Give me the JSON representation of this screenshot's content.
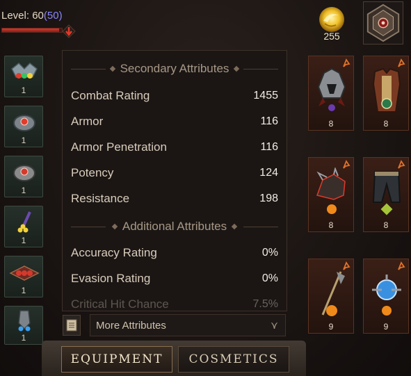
{
  "header": {
    "level_label": "Level: 60",
    "paragon_level": "(50)",
    "xp_fraction": 0.95
  },
  "currency": {
    "amount": "255",
    "icon": "gold-orb-icon"
  },
  "left_slots": [
    {
      "name": "helm-gem-slot",
      "level": "1",
      "icon": "crown-gem-icon"
    },
    {
      "name": "ring-slot-1",
      "level": "1",
      "icon": "ring-icon"
    },
    {
      "name": "ring-slot-2",
      "level": "1",
      "icon": "ring-icon"
    },
    {
      "name": "wand-slot",
      "level": "1",
      "icon": "wand-icon"
    },
    {
      "name": "belt-slot",
      "level": "1",
      "icon": "belt-icon"
    },
    {
      "name": "neck-slot",
      "level": "1",
      "icon": "amulet-icon"
    }
  ],
  "secondary": {
    "title": "Secondary Attributes",
    "rows": [
      {
        "name": "Combat Rating",
        "value": "1455"
      },
      {
        "name": "Armor",
        "value": "116"
      },
      {
        "name": "Armor Penetration",
        "value": "116"
      },
      {
        "name": "Potency",
        "value": "124"
      },
      {
        "name": "Resistance",
        "value": "198"
      }
    ]
  },
  "additional": {
    "title": "Additional Attributes",
    "rows": [
      {
        "name": "Accuracy Rating",
        "value": "0%"
      },
      {
        "name": "Evasion Rating",
        "value": "0%"
      },
      {
        "name": "Critical Hit Chance",
        "value": "7.5%"
      }
    ]
  },
  "more": {
    "label": "More Attributes",
    "chevron": "⋎"
  },
  "tabs": {
    "equipment": "EQUIPMENT",
    "cosmetics": "COSMETICS"
  },
  "gear_slots": [
    {
      "name": "helmet-slot",
      "level": "8",
      "icon": "helmet-icon"
    },
    {
      "name": "chest-slot",
      "level": "8",
      "icon": "chest-armor-icon"
    },
    {
      "name": "shoulder-slot",
      "level": "8",
      "icon": "shoulder-icon"
    },
    {
      "name": "legs-slot",
      "level": "8",
      "icon": "pants-icon"
    },
    {
      "name": "main-hand-slot",
      "level": "9",
      "icon": "staff-icon"
    },
    {
      "name": "off-hand-slot",
      "level": "9",
      "icon": "orb-icon"
    }
  ],
  "colors": {
    "accent_gold": "#e9b72b",
    "rarity_legendary": "#e0722a",
    "xp_red": "#d43a2c"
  }
}
